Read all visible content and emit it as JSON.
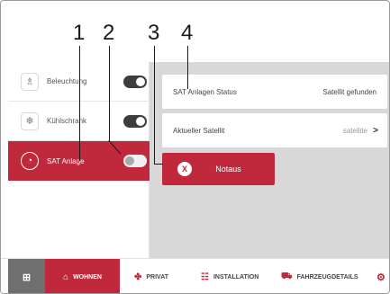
{
  "callouts": [
    "1",
    "2",
    "3",
    "4"
  ],
  "sidebar": {
    "items": [
      {
        "label": "Beleuchtung",
        "icon": "lightbulb-icon",
        "glyph": "♗",
        "on": true
      },
      {
        "label": "Kühlschrank",
        "icon": "snowflake-icon",
        "glyph": "❄",
        "on": true
      },
      {
        "label": "SAT Anlage",
        "icon": "satellite-dish-icon",
        "glyph": "◔",
        "on": false,
        "active": true
      }
    ]
  },
  "content": {
    "status": {
      "label": "SAT Anlagen Status",
      "value": "Satellit gefunden"
    },
    "satellite": {
      "label": "Aktueller Satellit",
      "value": "satellite",
      "chevron": ">"
    },
    "notaus": {
      "label": "Notaus",
      "icon": "close-icon",
      "glyph": "X"
    }
  },
  "bottom_nav": {
    "menu_icon": "grid-icon",
    "menu_glyph": "⊞",
    "items": [
      {
        "label": "WOHNEN",
        "icon": "home-icon",
        "glyph": "⌂",
        "active": true
      },
      {
        "label": "PRIVAT",
        "icon": "private-icon",
        "glyph": "✤"
      },
      {
        "label": "INSTALLATION",
        "icon": "installation-icon",
        "glyph": "☷"
      },
      {
        "label": "FAHRZEUGDETAILS",
        "icon": "vehicle-icon",
        "glyph": "⛟"
      }
    ],
    "settings_icon": "gear-icon",
    "settings_glyph": "⚙"
  },
  "colors": {
    "accent": "#c0283b",
    "panel": "#d8d8d8",
    "toggle_on": "#3d3d3d"
  }
}
